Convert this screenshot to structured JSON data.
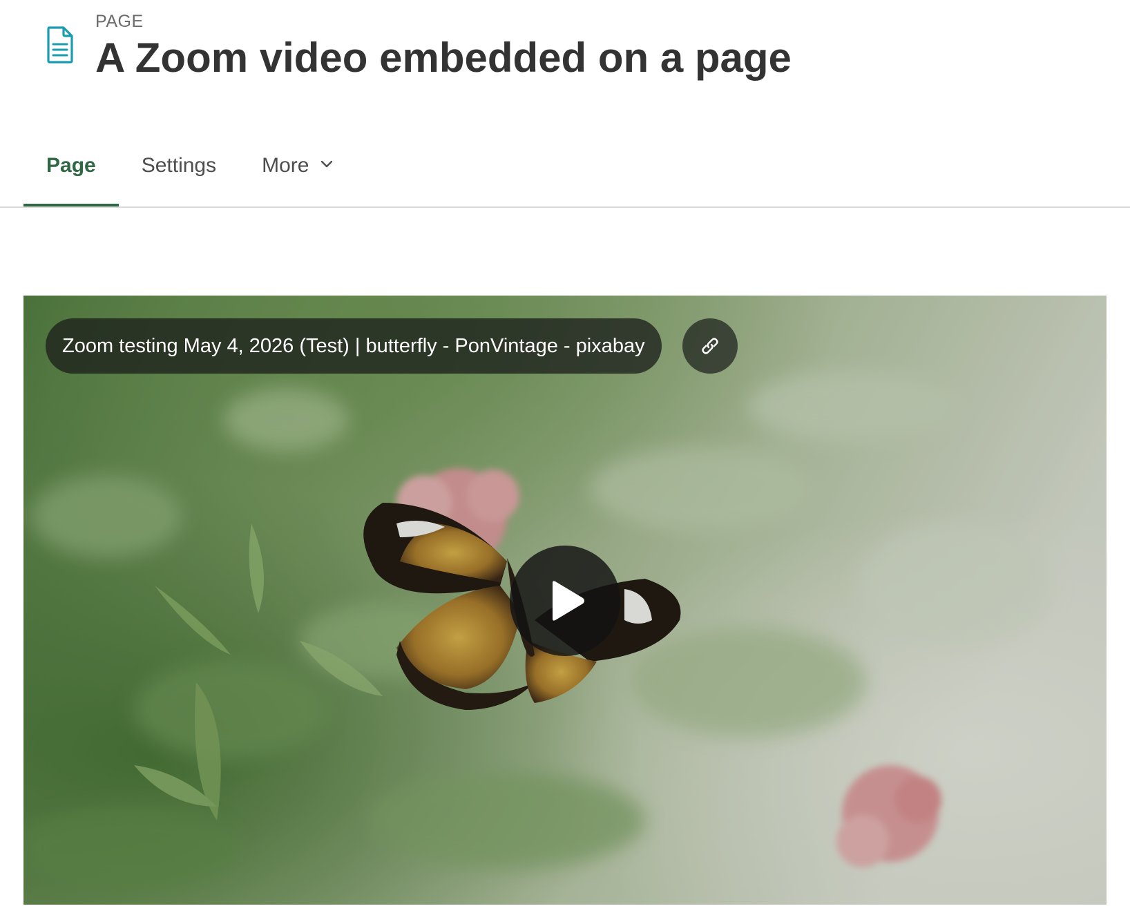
{
  "header": {
    "kicker": "PAGE",
    "title": "A Zoom video embedded on a page",
    "icon": "document-icon",
    "icon_color": "#1a9bb0"
  },
  "tabs": [
    {
      "label": "Page",
      "active": true
    },
    {
      "label": "Settings",
      "active": false
    },
    {
      "label": "More",
      "active": false,
      "icon": "chevron-down-icon"
    }
  ],
  "accent_color": "#2f6844",
  "video": {
    "title": "Zoom testing May 4, 2026 (Test) | butterfly - PonVintage - pixabay",
    "link_icon": "link-icon",
    "play_icon": "play-icon",
    "poster": "butterfly-on-flower-image"
  }
}
